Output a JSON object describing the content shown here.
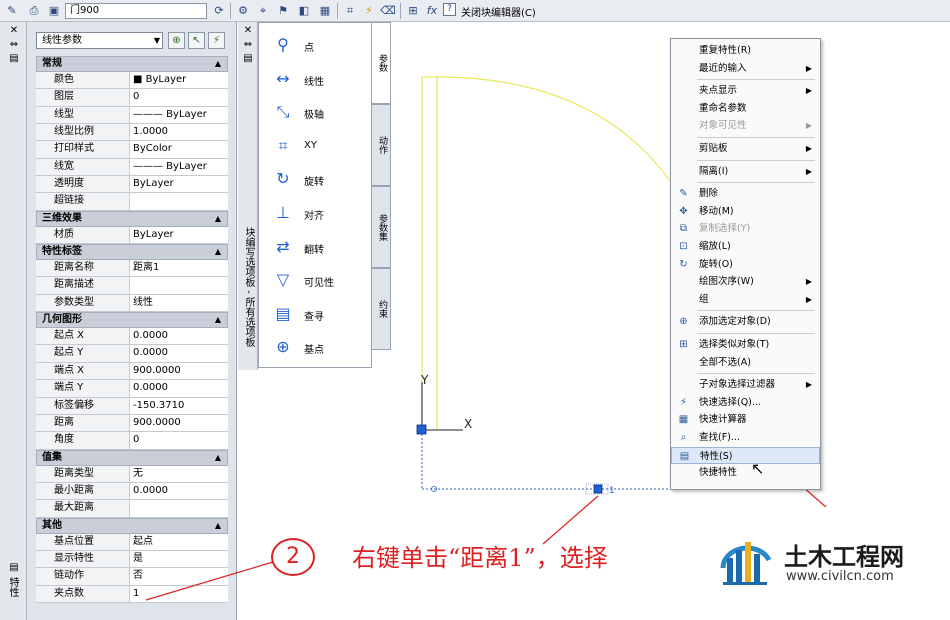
{
  "toolbar": {
    "block_name": "门900",
    "close_editor_label": "关闭块编辑器(C)",
    "icons": [
      "block-edit-icon",
      "save-block-icon",
      "save-as-icon",
      "attribute-icon",
      "test-block-icon",
      "parameter-icon",
      "action-icon",
      "visibility-icon",
      "table-icon",
      "point-icon",
      "lightning-icon",
      "tag-icon",
      "define-attribute-icon",
      "fx-icon",
      "help-icon"
    ]
  },
  "properties": {
    "strip_title": "特性",
    "object_type": "线性参数",
    "sections": [
      {
        "title": "常规",
        "rows": [
          {
            "name": "颜色",
            "value": "■ ByLayer"
          },
          {
            "name": "图层",
            "value": "0"
          },
          {
            "name": "线型",
            "value": "——— ByLayer"
          },
          {
            "name": "线型比例",
            "value": "1.0000"
          },
          {
            "name": "打印样式",
            "value": "ByColor"
          },
          {
            "name": "线宽",
            "value": "——— ByLayer"
          },
          {
            "name": "透明度",
            "value": "ByLayer"
          },
          {
            "name": "超链接",
            "value": ""
          }
        ]
      },
      {
        "title": "三维效果",
        "rows": [
          {
            "name": "材质",
            "value": "ByLayer"
          }
        ]
      },
      {
        "title": "特性标签",
        "rows": [
          {
            "name": "距离名称",
            "value": "距离1"
          },
          {
            "name": "距离描述",
            "value": ""
          },
          {
            "name": "参数类型",
            "value": "线性"
          }
        ]
      },
      {
        "title": "几何图形",
        "rows": [
          {
            "name": "起点 X",
            "value": "0.0000"
          },
          {
            "name": "起点 Y",
            "value": "0.0000"
          },
          {
            "name": "端点 X",
            "value": "900.0000"
          },
          {
            "name": "端点 Y",
            "value": "0.0000"
          },
          {
            "name": "标签偏移",
            "value": "-150.3710"
          },
          {
            "name": "距离",
            "value": "900.0000"
          },
          {
            "name": "角度",
            "value": "0"
          }
        ]
      },
      {
        "title": "值集",
        "rows": [
          {
            "name": "距离类型",
            "value": "无"
          },
          {
            "name": "最小距离",
            "value": "0.0000"
          },
          {
            "name": "最大距离",
            "value": ""
          }
        ]
      },
      {
        "title": "其他",
        "rows": [
          {
            "name": "基点位置",
            "value": "起点"
          },
          {
            "name": "显示特性",
            "value": "是"
          },
          {
            "name": "链动作",
            "value": "否"
          },
          {
            "name": "夹点数",
            "value": "1"
          }
        ]
      }
    ]
  },
  "block_palette": {
    "title": "块编写选项板 - 所有选项板",
    "tools": [
      {
        "label": "点",
        "icon": "point-param-icon"
      },
      {
        "label": "线性",
        "icon": "linear-param-icon"
      },
      {
        "label": "极轴",
        "icon": "polar-param-icon"
      },
      {
        "label": "XY",
        "icon": "xy-param-icon"
      },
      {
        "label": "旋转",
        "icon": "rotation-param-icon"
      },
      {
        "label": "对齐",
        "icon": "alignment-param-icon"
      },
      {
        "label": "翻转",
        "icon": "flip-param-icon"
      },
      {
        "label": "可见性",
        "icon": "visibility-param-icon"
      },
      {
        "label": "查寻",
        "icon": "lookup-param-icon"
      },
      {
        "label": "基点",
        "icon": "basepoint-param-icon"
      }
    ],
    "tabs": [
      "参数",
      "动作",
      "参数集",
      "约束"
    ]
  },
  "drawing": {
    "axis_y_label": "Y",
    "axis_x_label": "X",
    "grip_number": "1"
  },
  "context_menu": {
    "items": [
      {
        "label": "重复特性(R)",
        "submenu": false,
        "disabled": false,
        "icon": ""
      },
      {
        "label": "最近的输入",
        "submenu": true,
        "disabled": false,
        "icon": ""
      },
      {
        "sep": true
      },
      {
        "label": "夹点显示",
        "submenu": true,
        "disabled": false,
        "icon": ""
      },
      {
        "label": "重命名参数",
        "submenu": false,
        "disabled": false,
        "icon": ""
      },
      {
        "label": "对象可见性",
        "submenu": true,
        "disabled": true,
        "icon": ""
      },
      {
        "sep": true
      },
      {
        "label": "剪贴板",
        "submenu": true,
        "disabled": false,
        "icon": ""
      },
      {
        "sep": true
      },
      {
        "label": "隔离(I)",
        "submenu": true,
        "disabled": false,
        "icon": ""
      },
      {
        "sep": true
      },
      {
        "label": "删除",
        "submenu": false,
        "disabled": false,
        "icon": "eraser-icon"
      },
      {
        "label": "移动(M)",
        "submenu": false,
        "disabled": false,
        "icon": "move-icon"
      },
      {
        "label": "复制选择(Y)",
        "submenu": false,
        "disabled": true,
        "icon": "copy-icon"
      },
      {
        "label": "缩放(L)",
        "submenu": false,
        "disabled": false,
        "icon": "scale-icon"
      },
      {
        "label": "旋转(O)",
        "submenu": false,
        "disabled": false,
        "icon": "rotate-icon"
      },
      {
        "label": "绘图次序(W)",
        "submenu": true,
        "disabled": false,
        "icon": ""
      },
      {
        "label": "组",
        "submenu": true,
        "disabled": false,
        "icon": ""
      },
      {
        "sep": true
      },
      {
        "label": "添加选定对象(D)",
        "submenu": false,
        "disabled": false,
        "icon": "add-selected-icon"
      },
      {
        "sep": true
      },
      {
        "label": "选择类似对象(T)",
        "submenu": false,
        "disabled": false,
        "icon": "select-similar-icon"
      },
      {
        "label": "全部不选(A)",
        "submenu": false,
        "disabled": false,
        "icon": ""
      },
      {
        "sep": true
      },
      {
        "label": "子对象选择过滤器",
        "submenu": true,
        "disabled": false,
        "icon": ""
      },
      {
        "label": "快速选择(Q)...",
        "submenu": false,
        "disabled": false,
        "icon": "quick-select-icon"
      },
      {
        "label": "快速计算器",
        "submenu": false,
        "disabled": false,
        "icon": "calculator-icon"
      },
      {
        "label": "查找(F)...",
        "submenu": false,
        "disabled": false,
        "icon": "find-icon"
      },
      {
        "label": "特性(S)",
        "submenu": false,
        "disabled": false,
        "icon": "properties-icon",
        "highlight": true
      },
      {
        "label": "快捷特性",
        "submenu": false,
        "disabled": false,
        "icon": ""
      }
    ]
  },
  "annotation": {
    "step_number": "2",
    "instruction": "右键单击“距离1”，选择"
  },
  "watermark": {
    "title": "土木工程网",
    "url": "www.civilcn.com"
  },
  "colors": {
    "door_line": "#e8e85a",
    "grip": "#1f5fd8",
    "annotation": "#e02020",
    "dim_line": "#3060c0"
  }
}
